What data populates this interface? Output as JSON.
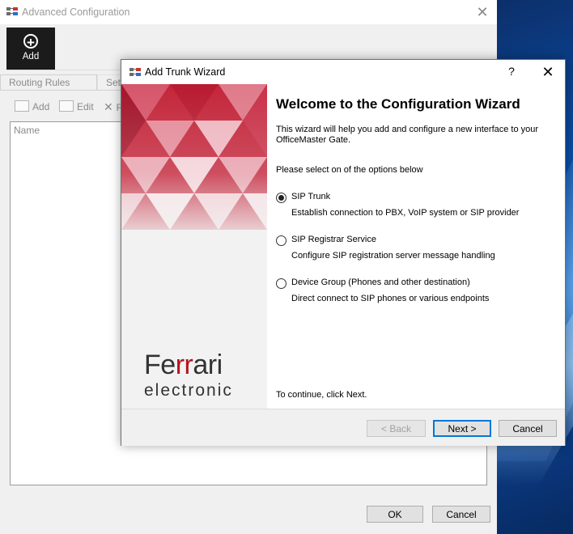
{
  "background_window": {
    "title": "Advanced Configuration",
    "toolbar": {
      "add_label": "Add"
    },
    "tabs": [
      "Routing Rules (SIP)",
      "Sett"
    ],
    "subtoolbar": {
      "add_label": "Add",
      "edit_label": "Edit",
      "remove_label": "R"
    },
    "list_header": "Name",
    "ok_label": "OK",
    "cancel_label": "Cancel"
  },
  "wizard": {
    "title": "Add Trunk Wizard",
    "help_label": "?",
    "heading": "Welcome to the Configuration Wizard",
    "intro": "This wizard will help you add and configure a new interface to your OfficeMaster Gate.",
    "select_label": "Please select on of the options below",
    "options": [
      {
        "title": "SIP Trunk",
        "description": "Establish connection to PBX, VoIP system or SIP provider",
        "selected": true
      },
      {
        "title": "SIP Registrar Service",
        "description": "Configure SIP registration server message handling",
        "selected": false
      },
      {
        "title": "Device Group (Phones and other destination)",
        "description": "Direct connect to SIP phones or various endpoints",
        "selected": false
      }
    ],
    "continue_text": "To continue, click Next.",
    "back_label": "< Back",
    "next_label": "Next >",
    "cancel_label": "Cancel",
    "logo": {
      "line1_a": "Fe",
      "line1_b": "rr",
      "line1_c": "ari",
      "line2": "electronic"
    }
  },
  "colors": {
    "brand_red": "#b5121b",
    "focus_blue": "#0078d7"
  }
}
